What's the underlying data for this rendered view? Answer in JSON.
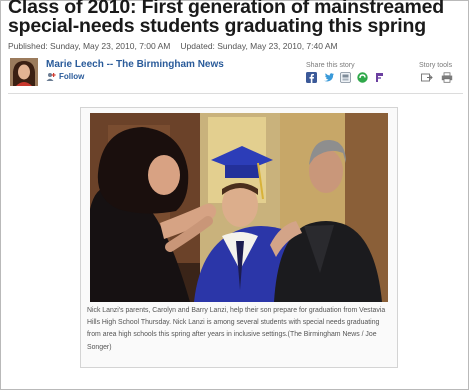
{
  "article": {
    "headline": "Class of 2010: First generation of mainstreamed special-needs students graduating this spring",
    "published": "Published: Sunday, May 23, 2010, 7:00 AM",
    "updated": "Updated: Sunday, May 23, 2010, 7:40 AM"
  },
  "byline": {
    "author": "Marie Leech -- The Birmingham News",
    "follow_label": "Follow"
  },
  "share": {
    "title": "Share this story",
    "icons": [
      "facebook-icon",
      "twitter-icon",
      "digg-icon",
      "stumbleupon-icon",
      "yahoo-buzz-icon"
    ]
  },
  "tools": {
    "title": "Story tools",
    "icons": [
      "email-icon",
      "print-icon"
    ]
  },
  "photo": {
    "caption": "Nick Lanzi's parents, Carolyn and Barry Lanzi, help their son prepare for graduation from Vestavia Hills High School Thursday. Nick Lanzi is among several students with special needs graduating from area high schools this spring after years in inclusive settings.(The Birmingham News / Joe Songer)"
  },
  "colors": {
    "link_blue": "#2a5b9a",
    "headline": "#1a1a1a",
    "gown_blue": "#2b36a8",
    "meta_gray": "#555555"
  }
}
